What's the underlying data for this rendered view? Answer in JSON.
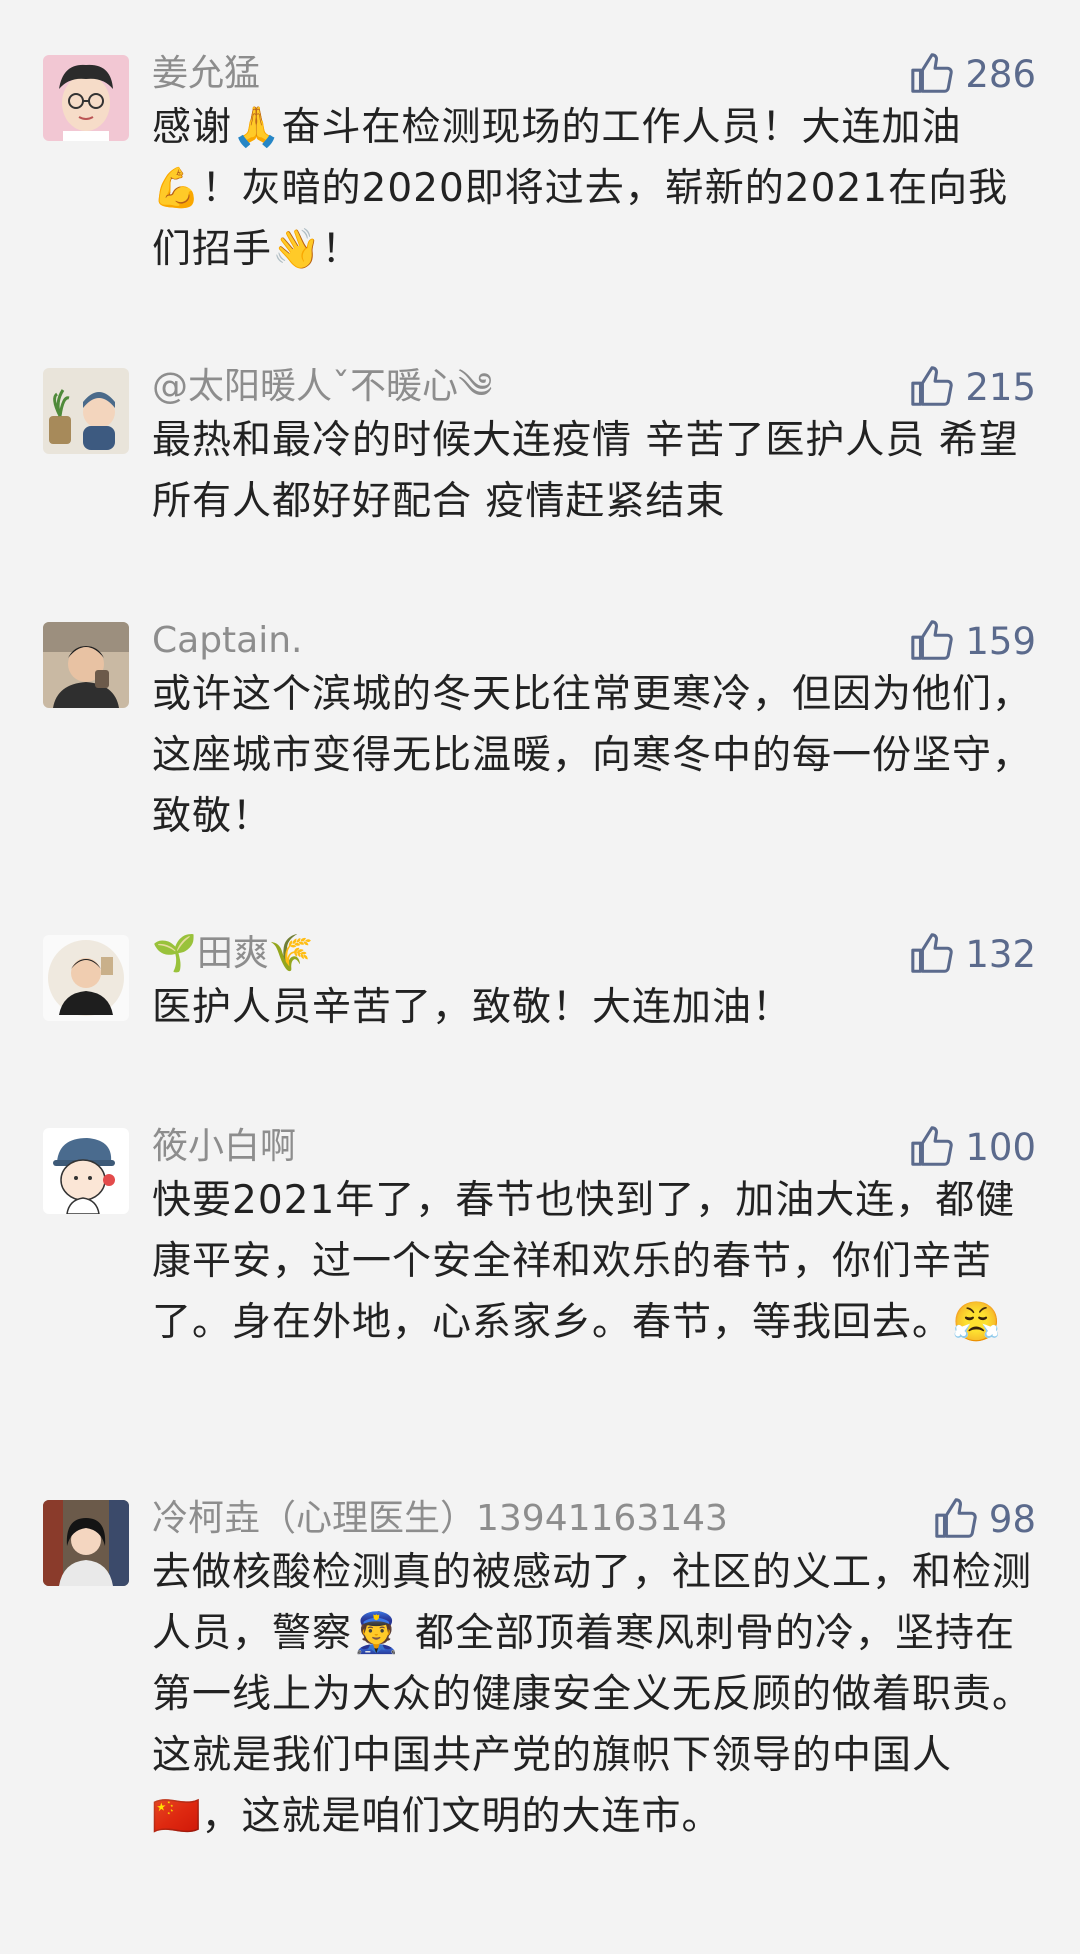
{
  "comments": [
    {
      "username": "姜允猛",
      "likes": "286",
      "text": "感谢🙏奋斗在检测现场的工作人员！大连加油💪！灰暗的2020即将过去，崭新的2021在向我们招手👋！"
    },
    {
      "username": "@太阳暖人ˇ不暖心༄",
      "likes": "215",
      "text": "最热和最冷的时候大连疫情 辛苦了医护人员 希望所有人都好好配合 疫情赶紧结束"
    },
    {
      "username": "Captain.",
      "likes": "159",
      "text": "或许这个滨城的冬天比往常更寒冷，但因为他们，这座城市变得无比温暖，向寒冬中的每一份坚守，致敬！"
    },
    {
      "username": "🌱田爽🌾",
      "likes": "132",
      "text": "医护人员辛苦了，致敬！大连加油！"
    },
    {
      "username": "筱小白啊",
      "likes": "100",
      "text": "快要2021年了，春节也快到了，加油大连，都健康平安，过一个安全祥和欢乐的春节，你们辛苦了。身在外地，心系家乡。春节，等我回去。😤"
    },
    {
      "username": "冷柯垚（心理医生）13941163143",
      "likes": "98",
      "text": "去做核酸检测真的被感动了，社区的义工，和检测人员，警察👮 都全部顶着寒风刺骨的冷，坚持在第一线上为大众的健康安全义无反顾的做着职责。这就是我们中国共产党的旗帜下领导的中国人🇨🇳，这就是咱们文明的大连市。"
    }
  ]
}
